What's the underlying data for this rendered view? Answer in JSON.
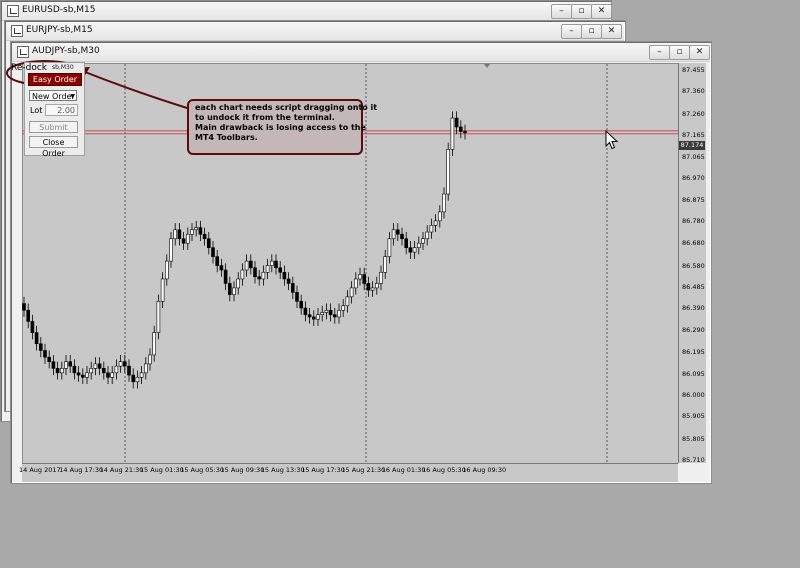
{
  "windows": [
    {
      "title": "EURUSD-sb,M15"
    },
    {
      "title": "EURJPY-sb,M15"
    },
    {
      "title": "AUDJPY-sb,M30"
    }
  ],
  "panel": {
    "redock_label": "Re-dock",
    "timeframe_label": "sb,M30",
    "easy_order_label": "Easy Order",
    "order_type": "New Order",
    "lot_label": "Lot",
    "lot_value": "2.00",
    "submit_label": "Submit",
    "close_label": "Close Order"
  },
  "annotation": {
    "lines": [
      "each chart needs script dragging onto it",
      "to undock it from the terminal.",
      "Main drawback is losing access to the",
      "MT4 Toolbars."
    ]
  },
  "colors": {
    "chart_bg": "#c8c8c8",
    "accent_dark_red": "#5c0b0b",
    "easy_order_bg": "#8b0000",
    "price_line": "#c04040"
  },
  "chart_data": {
    "type": "candlestick",
    "current_price_label": "87.174",
    "y_ticks": [
      "87.455",
      "87.360",
      "87.260",
      "87.165",
      "87.065",
      "86.970",
      "86.875",
      "86.780",
      "86.680",
      "86.580",
      "86.485",
      "86.390",
      "86.290",
      "86.195",
      "86.095",
      "86.000",
      "85.905",
      "85.805",
      "85.710"
    ],
    "x_ticks": [
      "14 Aug 2017",
      "14 Aug 17:30",
      "14 Aug 21:30",
      "15 Aug 01:30",
      "15 Aug 05:30",
      "15 Aug 09:30",
      "15 Aug 13:30",
      "15 Aug 17:30",
      "15 Aug 21:30",
      "16 Aug 01:30",
      "16 Aug 05:30",
      "16 Aug 09:30"
    ],
    "ylim": [
      85.71,
      87.455
    ],
    "closes": [
      86.38,
      86.33,
      86.28,
      86.23,
      86.2,
      86.17,
      86.15,
      86.12,
      86.1,
      86.12,
      86.15,
      86.13,
      86.1,
      86.09,
      86.08,
      86.1,
      86.12,
      86.14,
      86.12,
      86.1,
      86.08,
      86.1,
      86.13,
      86.15,
      86.13,
      86.09,
      86.06,
      86.08,
      86.1,
      86.14,
      86.18,
      86.28,
      86.42,
      86.52,
      86.6,
      86.7,
      86.74,
      86.7,
      86.68,
      86.72,
      86.74,
      86.75,
      86.72,
      86.7,
      86.66,
      86.62,
      86.58,
      86.56,
      86.5,
      86.45,
      86.48,
      86.52,
      86.56,
      86.6,
      86.57,
      86.53,
      86.52,
      86.55,
      86.58,
      86.6,
      86.57,
      86.55,
      86.52,
      86.5,
      86.46,
      86.42,
      86.39,
      86.36,
      86.35,
      86.34,
      86.36,
      86.37,
      86.38,
      86.36,
      86.35,
      86.38,
      86.4,
      86.44,
      86.48,
      86.52,
      86.54,
      86.5,
      86.47,
      86.48,
      86.5,
      86.55,
      86.62,
      86.7,
      86.74,
      86.72,
      86.7,
      86.66,
      86.64,
      86.66,
      86.68,
      86.7,
      86.73,
      86.76,
      86.78,
      86.82,
      86.9,
      87.1,
      87.24,
      87.2,
      87.18,
      87.174
    ]
  }
}
